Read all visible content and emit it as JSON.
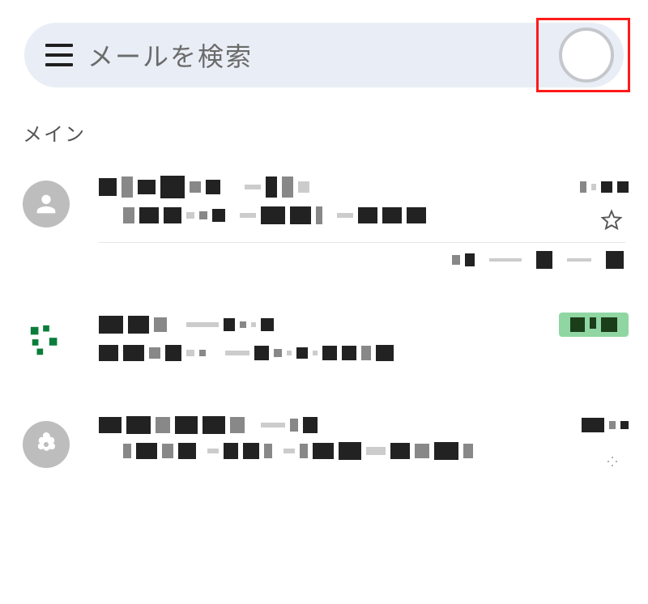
{
  "search": {
    "placeholder": "メールを検索"
  },
  "section": {
    "label": "メイン"
  },
  "mails": [
    {
      "avatar_type": "person",
      "sender_obf": true,
      "time_obf": true,
      "has_badge": false,
      "has_star": true
    },
    {
      "avatar_type": "tag",
      "sender_obf": true,
      "time_obf": true,
      "has_badge": true,
      "has_star": false
    },
    {
      "avatar_type": "flower",
      "sender_obf": true,
      "time_obf": true,
      "has_badge": false,
      "has_star": true
    }
  ]
}
